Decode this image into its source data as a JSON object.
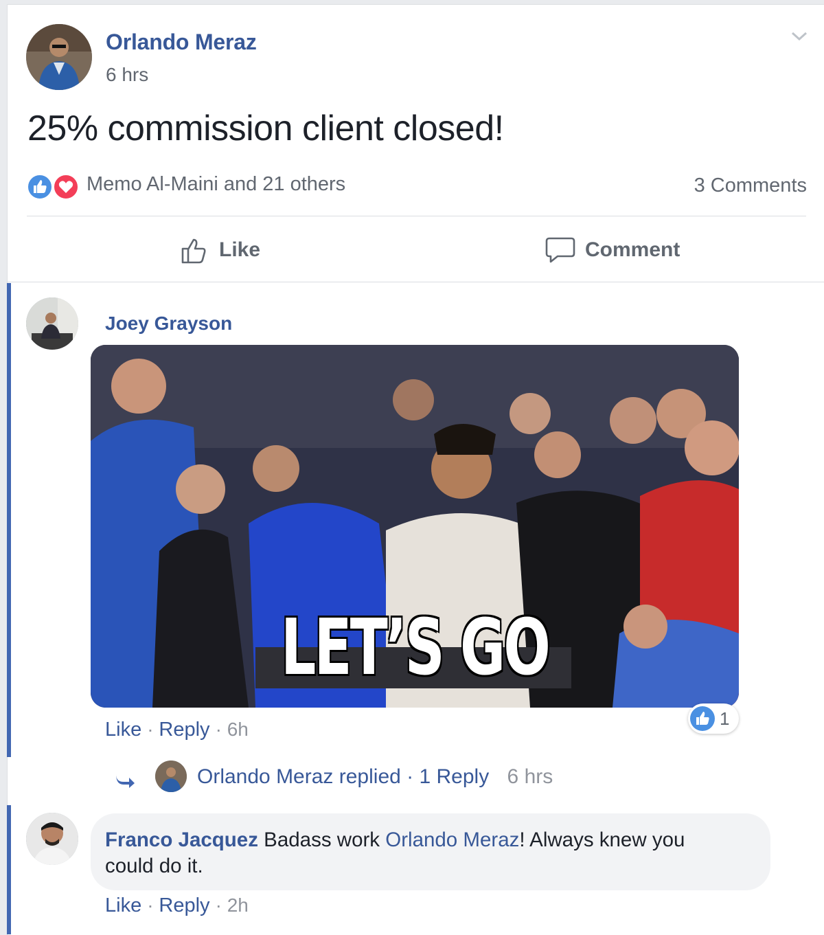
{
  "post": {
    "author": "Orlando Meraz",
    "time": "6 hrs",
    "text": "25% commission client closed!",
    "reactions_text": "Memo Al-Maini and 21 others",
    "comments_count": "3 Comments",
    "actions": {
      "like": "Like",
      "comment": "Comment"
    }
  },
  "comments": [
    {
      "author": "Joey Grayson",
      "gif_caption": "LET’S GO",
      "reaction_count": "1",
      "actions": {
        "like": "Like",
        "reply": "Reply",
        "time": "6h"
      },
      "replies_summary": {
        "author_replied": "Orlando Meraz replied",
        "reply_count": "1 Reply",
        "time": "6 hrs"
      }
    },
    {
      "author": "Franco Jacquez",
      "text_pre": "Badass work",
      "mention": "Orlando Meraz",
      "text_post": "! Always knew you",
      "text_line2": "could do it.",
      "actions": {
        "like": "Like",
        "reply": "Reply",
        "time": "2h"
      }
    }
  ],
  "colors": {
    "link": "#385898",
    "like_blue": "#4267b2",
    "love_red": "#f33e58"
  }
}
